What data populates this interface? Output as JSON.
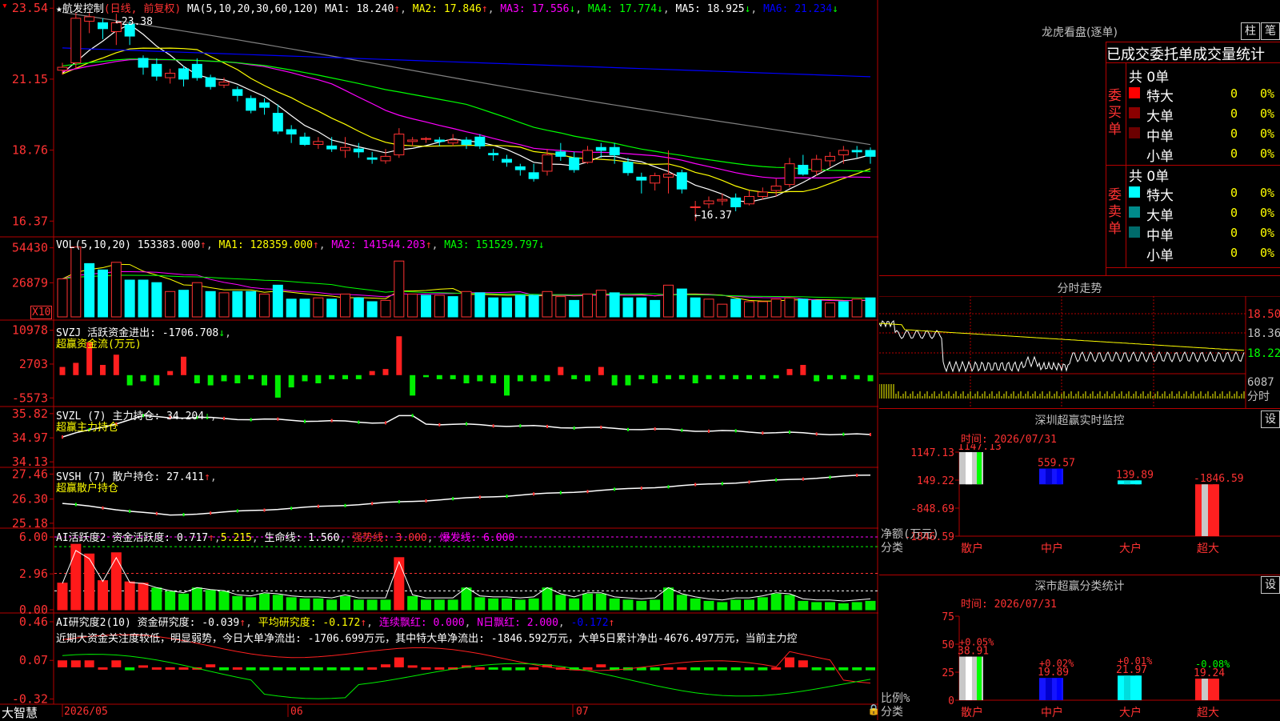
{
  "stock": {
    "name": "航发控制",
    "period_label": "(日线, 前复权)"
  },
  "ma_header": {
    "prefix": "MA(5,10,20,30,60,120)",
    "ma1": "MA1: 18.240",
    "ma1_arrow": "↑",
    "ma2": "MA2: 17.846",
    "ma2_arrow": "↑",
    "ma3": "MA3: 17.556",
    "ma3_arrow": "↓",
    "ma4": "MA4: 17.774",
    "ma4_arrow": "↓",
    "ma5": "MA5: 18.925",
    "ma5_arrow": "↓",
    "ma6": "MA6: 21.234",
    "ma6_arrow": "↓"
  },
  "price_axis": [
    "23.54",
    "21.15",
    "18.76",
    "16.37"
  ],
  "price_annotations": {
    "high": "23.38",
    "low": "16.37"
  },
  "vol_header": {
    "prefix": "VOL(5,10,20)",
    "value": "153383.000",
    "ma1": "MA1: 128359.000",
    "ma2": "MA2: 141544.203",
    "ma3": "MA3: 151529.797"
  },
  "vol_axis": [
    "54430",
    "26879"
  ],
  "vol_unit": "X10",
  "flow_header": {
    "prefix": "SVZJ  活跃资金进出: -1706.708",
    "sub": "超赢资金流(万元)"
  },
  "flow_axis": [
    "10978",
    "2703",
    "-5573"
  ],
  "zl_header": {
    "prefix": "SVZL (7) 主力持仓: 34.204",
    "sub": "超赢主力持仓"
  },
  "zl_axis": [
    "35.82",
    "34.97",
    "34.13"
  ],
  "sh_header": {
    "prefix": "SVSH (7) 散户持仓: 27.411",
    "sub": "超赢散户持仓"
  },
  "sh_axis": [
    "27.46",
    "26.30",
    "25.18"
  ],
  "ai_header": {
    "prefix": "AI活跃度2 资金活跃度: 0.717",
    "v2": "5.215",
    "life": "生命线: 1.560",
    "strong": "强势线: 3.000",
    "burst": "爆发线: 6.000"
  },
  "ai_axis": [
    "6.00",
    "2.96",
    "0.00"
  ],
  "ai2_header": {
    "prefix": "AI研究度2(10) 资金研究度: -0.039",
    "avg": "平均研究度: -0.172",
    "red": "连续飘红: 0.000",
    "nred": "N日飘红: 2.000",
    "last": "-0.172"
  },
  "ai2_axis": [
    "0.46",
    "0.07",
    "-0.32"
  ],
  "comment": "近期大资金关注度较低，明显弱势，今日大单净流出: -1706.699万元，其中特大单净流出: -1846.592万元，大单5日累计净出-4676.497万元，当前主力控",
  "date_axis": [
    "2026/05",
    "06",
    "07"
  ],
  "footer_brand": "大智慧",
  "right": {
    "lhb": {
      "title": "龙虎看盘(逐单)",
      "btn1": "柱",
      "btn2": "笔",
      "tab": "已成交委托单成交量统计",
      "buy_side": "委买单",
      "sell_side": "委卖单",
      "buy_total": "共 0单",
      "sell_total": "共 0单",
      "buy_rows": [
        {
          "label": "特大",
          "val": "0",
          "pct": "0%",
          "color": "#ff0000"
        },
        {
          "label": "大单",
          "val": "0",
          "pct": "0%",
          "color": "#8b0000"
        },
        {
          "label": "中单",
          "val": "0",
          "pct": "0%",
          "color": "#6b0000"
        },
        {
          "label": "小单",
          "val": "0",
          "pct": "0%",
          "color": "#000000"
        }
      ],
      "sell_rows": [
        {
          "label": "特大",
          "val": "0",
          "pct": "0%",
          "color": "#00ffff"
        },
        {
          "label": "大单",
          "val": "0",
          "pct": "0%",
          "color": "#008b8b"
        },
        {
          "label": "中单",
          "val": "0",
          "pct": "0%",
          "color": "#006b6b"
        },
        {
          "label": "小单",
          "val": "0",
          "pct": "0%",
          "color": "#000000"
        }
      ]
    },
    "fs": {
      "title": "分时走势",
      "axis": [
        "18.50",
        "18.36",
        "18.22"
      ],
      "vol": "6087",
      "vol_unit": "分时"
    },
    "sz_monitor": {
      "title": "深圳超赢实时监控",
      "btn": "设",
      "time": "时间: 2026/07/31",
      "axis": [
        "1147.13",
        "149.22",
        "-848.69",
        "-1846.59"
      ],
      "bars": [
        {
          "label": "散户",
          "value": 1147.13,
          "text": "1147.13"
        },
        {
          "label": "中户",
          "value": 559.57,
          "text": "559.57"
        },
        {
          "label": "大户",
          "value": 139.89,
          "text": "139.89"
        },
        {
          "label": "超大",
          "value": -1846.59,
          "text": "-1846.59"
        }
      ],
      "ylabel": "净额(万元)",
      "xlabel": "分类"
    },
    "sz_stat": {
      "title": "深市超赢分类统计",
      "btn": "设",
      "time": "时间: 2026/07/31",
      "axis": [
        "75",
        "50",
        "25",
        "0"
      ],
      "bars": [
        {
          "label": "散户",
          "value": 38.91,
          "text": "38.91",
          "delta": "+0.05%"
        },
        {
          "label": "中户",
          "value": 19.89,
          "text": "19.89",
          "delta": "+0.02%"
        },
        {
          "label": "大户",
          "value": 21.97,
          "text": "21.97",
          "delta": "+0.01%"
        },
        {
          "label": "超大",
          "value": 19.24,
          "text": "19.24",
          "delta": "-0.08%"
        }
      ],
      "ylabel": "比例%",
      "xlabel": "分类"
    }
  },
  "colors": {
    "up": "#ff3232",
    "down": "#00ffff",
    "grid": "#b40000",
    "axis_text": "#ff3232",
    "ma1": "#ffffff",
    "ma2": "#ffff00",
    "ma3": "#ff00ff",
    "ma4": "#00ff00",
    "ma5": "#808080",
    "ma6": "#0000ff"
  },
  "chart_data": {
    "type": "candlestick",
    "candles": [
      {
        "o": 21.45,
        "c": 21.55,
        "h": 21.7,
        "l": 21.3
      },
      {
        "o": 21.7,
        "c": 23.2,
        "h": 23.38,
        "l": 21.5
      },
      {
        "o": 23.1,
        "c": 23.25,
        "h": 23.38,
        "l": 22.7
      },
      {
        "o": 23.05,
        "c": 22.85,
        "h": 23.2,
        "l": 22.5
      },
      {
        "o": 22.75,
        "c": 23.05,
        "h": 23.35,
        "l": 22.3
      },
      {
        "o": 23.0,
        "c": 22.6,
        "h": 23.1,
        "l": 22.3
      },
      {
        "o": 21.85,
        "c": 21.55,
        "h": 21.95,
        "l": 21.3
      },
      {
        "o": 21.65,
        "c": 21.25,
        "h": 21.85,
        "l": 21.1
      },
      {
        "o": 21.2,
        "c": 21.35,
        "h": 21.5,
        "l": 21.0
      },
      {
        "o": 21.5,
        "c": 21.15,
        "h": 21.6,
        "l": 20.9
      },
      {
        "o": 21.65,
        "c": 21.2,
        "h": 21.85,
        "l": 21.1
      },
      {
        "o": 21.2,
        "c": 20.9,
        "h": 21.3,
        "l": 20.8
      },
      {
        "o": 20.95,
        "c": 21.05,
        "h": 21.2,
        "l": 20.85
      },
      {
        "o": 20.8,
        "c": 20.6,
        "h": 20.9,
        "l": 20.4
      },
      {
        "o": 20.5,
        "c": 20.1,
        "h": 20.6,
        "l": 20.0
      },
      {
        "o": 20.35,
        "c": 20.2,
        "h": 20.5,
        "l": 19.95
      },
      {
        "o": 20.0,
        "c": 19.4,
        "h": 20.3,
        "l": 19.3
      },
      {
        "o": 19.45,
        "c": 19.3,
        "h": 19.6,
        "l": 19.0
      },
      {
        "o": 19.2,
        "c": 18.95,
        "h": 19.35,
        "l": 18.9
      },
      {
        "o": 18.95,
        "c": 19.05,
        "h": 19.2,
        "l": 18.8
      },
      {
        "o": 18.9,
        "c": 18.8,
        "h": 19.2,
        "l": 18.7
      },
      {
        "o": 18.75,
        "c": 18.85,
        "h": 19.2,
        "l": 18.5
      },
      {
        "o": 18.8,
        "c": 18.7,
        "h": 19.0,
        "l": 18.5
      },
      {
        "o": 18.5,
        "c": 18.45,
        "h": 18.7,
        "l": 18.3
      },
      {
        "o": 18.4,
        "c": 18.55,
        "h": 18.8,
        "l": 18.3
      },
      {
        "o": 18.6,
        "c": 19.3,
        "h": 19.5,
        "l": 18.5
      },
      {
        "o": 19.05,
        "c": 19.1,
        "h": 19.2,
        "l": 18.9
      },
      {
        "o": 19.15,
        "c": 19.15,
        "h": 19.2,
        "l": 19.0
      },
      {
        "o": 19.1,
        "c": 19.05,
        "h": 19.2,
        "l": 18.9
      },
      {
        "o": 19.0,
        "c": 19.1,
        "h": 19.3,
        "l": 18.9
      },
      {
        "o": 19.1,
        "c": 18.95,
        "h": 19.2,
        "l": 18.8
      },
      {
        "o": 19.2,
        "c": 18.9,
        "h": 19.3,
        "l": 18.8
      },
      {
        "o": 18.65,
        "c": 18.6,
        "h": 18.8,
        "l": 18.4
      },
      {
        "o": 18.45,
        "c": 18.35,
        "h": 18.6,
        "l": 18.2
      },
      {
        "o": 18.2,
        "c": 18.1,
        "h": 18.3,
        "l": 17.9
      },
      {
        "o": 18.0,
        "c": 17.8,
        "h": 18.3,
        "l": 17.7
      },
      {
        "o": 18.05,
        "c": 18.6,
        "h": 18.8,
        "l": 17.9
      },
      {
        "o": 18.7,
        "c": 18.55,
        "h": 19.0,
        "l": 18.4
      },
      {
        "o": 18.5,
        "c": 18.1,
        "h": 18.7,
        "l": 18.0
      },
      {
        "o": 18.35,
        "c": 18.75,
        "h": 18.9,
        "l": 18.3
      },
      {
        "o": 18.85,
        "c": 18.75,
        "h": 19.0,
        "l": 18.5
      },
      {
        "o": 18.85,
        "c": 18.6,
        "h": 19.0,
        "l": 18.3
      },
      {
        "o": 18.35,
        "c": 18.0,
        "h": 18.5,
        "l": 17.9
      },
      {
        "o": 17.85,
        "c": 17.75,
        "h": 18.0,
        "l": 17.3
      },
      {
        "o": 17.65,
        "c": 17.9,
        "h": 18.0,
        "l": 17.4
      },
      {
        "o": 17.85,
        "c": 17.95,
        "h": 18.75,
        "l": 17.3
      },
      {
        "o": 18.0,
        "c": 17.45,
        "h": 18.1,
        "l": 17.3
      },
      {
        "o": 16.85,
        "c": 16.85,
        "h": 17.05,
        "l": 16.37
      },
      {
        "o": 16.95,
        "c": 17.05,
        "h": 17.2,
        "l": 16.8
      },
      {
        "o": 17.05,
        "c": 17.1,
        "h": 17.3,
        "l": 16.9
      },
      {
        "o": 17.15,
        "c": 16.85,
        "h": 17.3,
        "l": 16.7
      },
      {
        "o": 16.95,
        "c": 17.2,
        "h": 17.4,
        "l": 16.9
      },
      {
        "o": 17.2,
        "c": 17.35,
        "h": 17.5,
        "l": 17.1
      },
      {
        "o": 17.4,
        "c": 17.55,
        "h": 17.8,
        "l": 17.2
      },
      {
        "o": 17.6,
        "c": 18.3,
        "h": 18.5,
        "l": 17.5
      },
      {
        "o": 18.25,
        "c": 17.95,
        "h": 18.6,
        "l": 17.9
      },
      {
        "o": 18.05,
        "c": 18.45,
        "h": 18.6,
        "l": 17.9
      },
      {
        "o": 18.4,
        "c": 18.55,
        "h": 18.7,
        "l": 18.2
      },
      {
        "o": 18.6,
        "c": 18.75,
        "h": 18.9,
        "l": 18.3
      },
      {
        "o": 18.75,
        "c": 18.7,
        "h": 18.9,
        "l": 18.5
      },
      {
        "o": 18.75,
        "c": 18.55,
        "h": 18.85,
        "l": 18.3
      }
    ],
    "volume": [
      {
        "v": 30000,
        "up": true
      },
      {
        "v": 55000,
        "up": true
      },
      {
        "v": 42000,
        "up": false
      },
      {
        "v": 37000,
        "up": false
      },
      {
        "v": 43000,
        "up": true
      },
      {
        "v": 29000,
        "up": false
      },
      {
        "v": 29000,
        "up": false
      },
      {
        "v": 27000,
        "up": false
      },
      {
        "v": 20000,
        "up": true
      },
      {
        "v": 21000,
        "up": false
      },
      {
        "v": 27000,
        "up": true
      },
      {
        "v": 20000,
        "up": false
      },
      {
        "v": 19000,
        "up": true
      },
      {
        "v": 20000,
        "up": false
      },
      {
        "v": 20000,
        "up": false
      },
      {
        "v": 18000,
        "up": true
      },
      {
        "v": 25000,
        "up": false
      },
      {
        "v": 14000,
        "up": false
      },
      {
        "v": 14000,
        "up": false
      },
      {
        "v": 15000,
        "up": true
      },
      {
        "v": 14000,
        "up": false
      },
      {
        "v": 18000,
        "up": true
      },
      {
        "v": 15000,
        "up": false
      },
      {
        "v": 12000,
        "up": false
      },
      {
        "v": 13000,
        "up": true
      },
      {
        "v": 44000,
        "up": true
      },
      {
        "v": 18000,
        "up": true
      },
      {
        "v": 17000,
        "up": false
      },
      {
        "v": 17000,
        "up": true
      },
      {
        "v": 16000,
        "up": false
      },
      {
        "v": 20000,
        "up": true
      },
      {
        "v": 19000,
        "up": false
      },
      {
        "v": 15000,
        "up": false
      },
      {
        "v": 15000,
        "up": false
      },
      {
        "v": 17000,
        "up": false
      },
      {
        "v": 17000,
        "up": false
      },
      {
        "v": 20000,
        "up": true
      },
      {
        "v": 16000,
        "up": true
      },
      {
        "v": 13000,
        "up": false
      },
      {
        "v": 18000,
        "up": true
      },
      {
        "v": 21000,
        "up": true
      },
      {
        "v": 19000,
        "up": false
      },
      {
        "v": 15000,
        "up": false
      },
      {
        "v": 15000,
        "up": false
      },
      {
        "v": 13000,
        "up": false
      },
      {
        "v": 25000,
        "up": true
      },
      {
        "v": 22000,
        "up": false
      },
      {
        "v": 15000,
        "up": false
      },
      {
        "v": 14000,
        "up": true
      },
      {
        "v": 10000,
        "up": true
      },
      {
        "v": 14000,
        "up": false
      },
      {
        "v": 12000,
        "up": true
      },
      {
        "v": 12000,
        "up": true
      },
      {
        "v": 14000,
        "up": true
      },
      {
        "v": 15000,
        "up": true
      },
      {
        "v": 14000,
        "up": false
      },
      {
        "v": 13000,
        "up": false
      },
      {
        "v": 11000,
        "up": true
      },
      {
        "v": 12000,
        "up": false
      },
      {
        "v": 14000,
        "up": true
      },
      {
        "v": 15000,
        "up": false
      }
    ],
    "flow": [
      2000,
      3000,
      8000,
      2500,
      5000,
      -2500,
      -1500,
      -2500,
      1000,
      4500,
      -2000,
      -2500,
      -1500,
      -2000,
      -1000,
      -2500,
      -5500,
      -3000,
      -1500,
      -2000,
      -1000,
      -1000,
      -1000,
      1000,
      1500,
      9500,
      -5000,
      -500,
      -1000,
      -1000,
      -2000,
      -1500,
      -2000,
      -5000,
      -1500,
      -1500,
      -1500,
      2000,
      -1000,
      -1500,
      2000,
      -2500,
      -2500,
      -1000,
      -2000,
      -1000,
      -1000,
      -2000,
      -1000,
      -1000,
      -1000,
      -1000,
      -1000,
      -800,
      1500,
      2500,
      -1500,
      -1000,
      -1000,
      -1000,
      -1500
    ],
    "ai": [
      2.2,
      5.4,
      4.6,
      2.4,
      4.7,
      2.3,
      2.2,
      1.8,
      1.5,
      1.3,
      1.8,
      1.6,
      1.5,
      1.1,
      1.0,
      1.3,
      1.2,
      1.0,
      0.9,
      0.9,
      0.8,
      1.1,
      0.8,
      0.8,
      0.8,
      4.3,
      1.1,
      0.8,
      0.8,
      0.8,
      1.8,
      1.0,
      0.9,
      0.9,
      0.8,
      0.9,
      1.8,
      1.2,
      0.9,
      1.3,
      1.3,
      0.9,
      0.8,
      0.7,
      0.8,
      1.8,
      1.2,
      0.9,
      0.7,
      0.6,
      0.8,
      0.8,
      1.0,
      1.3,
      1.2,
      0.7,
      0.6,
      0.6,
      0.5,
      0.6,
      0.7
    ],
    "ai2": [
      0.07,
      0.07,
      0.07,
      0.0,
      0.07,
      -0.03,
      0.02,
      0.0,
      0.0,
      0.0,
      0.0,
      0.03,
      -0.03,
      0.0,
      -0.03,
      -0.03,
      -0.03,
      -0.03,
      -0.03,
      -0.03,
      -0.03,
      -0.03,
      -0.03,
      0.0,
      0.03,
      0.1,
      0.02,
      0.0,
      0.0,
      0.0,
      0.02,
      0.0,
      -0.02,
      -0.03,
      -0.03,
      0.0,
      0.03,
      0.0,
      -0.03,
      0.0,
      0.03,
      -0.03,
      -0.03,
      -0.03,
      -0.03,
      0.0,
      0.0,
      -0.03,
      -0.03,
      -0.03,
      -0.03,
      -0.03,
      -0.03,
      0.0,
      0.1,
      0.07,
      -0.03,
      -0.03,
      -0.03,
      -0.03,
      -0.03
    ]
  }
}
